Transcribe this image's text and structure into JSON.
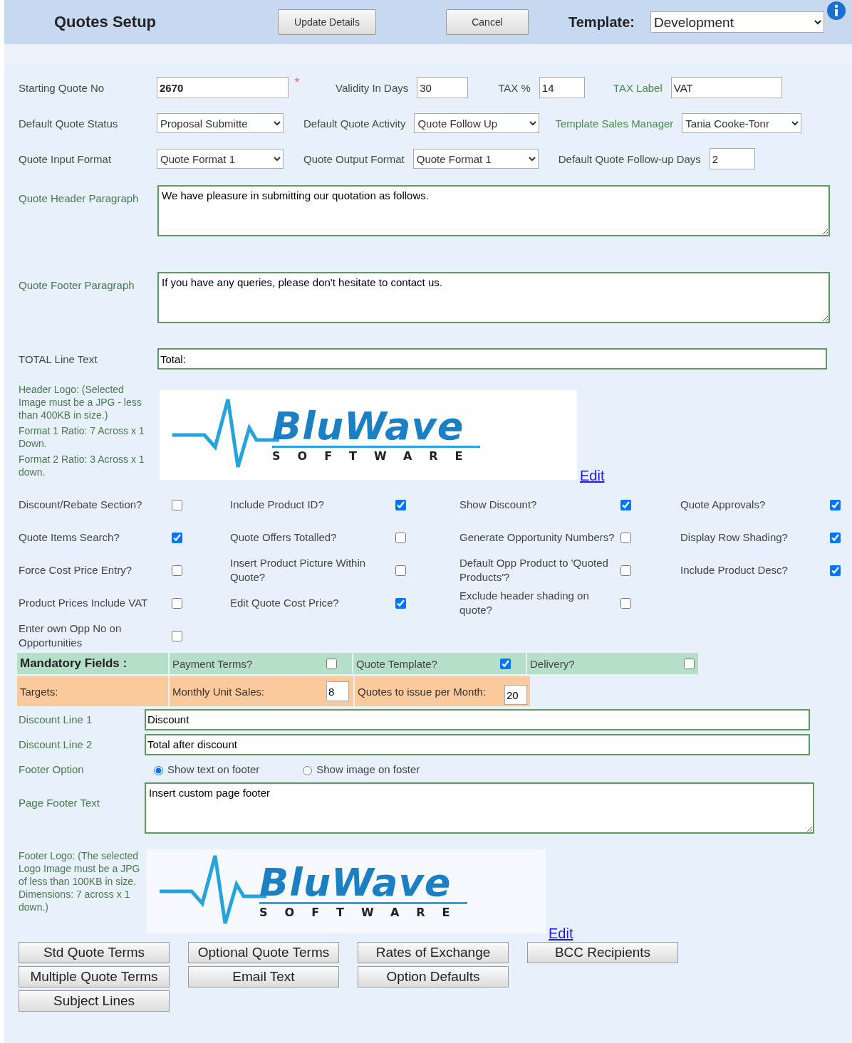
{
  "header": {
    "title": "Quotes Setup",
    "buttons": [
      "Update Details",
      "Cancel"
    ],
    "template_label": "Template:",
    "template_value": "Development"
  },
  "field_rows": [
    [
      {
        "label": "Starting Quote No",
        "kind": "input",
        "value": "2670",
        "required": true
      },
      {
        "label": "Validity In Days",
        "kind": "input",
        "value": "30"
      },
      {
        "label": "TAX %",
        "kind": "input",
        "value": "14"
      },
      {
        "label": "TAX Label",
        "kind": "input",
        "value": "VAT"
      }
    ],
    [
      {
        "label": "Default Quote Status",
        "kind": "select",
        "value": "Proposal Submitte"
      },
      {
        "label": "Default Quote Activity",
        "kind": "select",
        "value": "Quote Follow Up"
      },
      {
        "label": "Template Sales Manager",
        "kind": "select",
        "value": "Tania Cooke-Tonr"
      }
    ],
    [
      {
        "label": "Quote Input Format",
        "kind": "select",
        "value": "Quote Format 1"
      },
      {
        "label": "Quote Output Format",
        "kind": "select",
        "value": "Quote Format 1"
      },
      {
        "label": "Default Quote Follow-up Days",
        "kind": "input",
        "value": "2"
      }
    ]
  ],
  "paragraphs": [
    {
      "label": "Quote Header Paragraph",
      "value": "We have pleasure in submitting our quotation as follows."
    },
    {
      "label": "Quote Footer Paragraph",
      "value": "If you have any queries, please don't hesitate to contact us."
    }
  ],
  "total_line": {
    "label": "TOTAL Line Text",
    "value": "Total:"
  },
  "header_logo": {
    "notes": [
      "Header Logo: (Selected Image must be a JPG - less than 400KB in size.)",
      "Format 1 Ratio: 7 Across x 1 Down.",
      "Format 2 Ratio: 3 Across x 1 down."
    ],
    "wordmark": "BluWave",
    "tagline": "SOFTWARE",
    "edit": "Edit"
  },
  "options": [
    [
      {
        "label": "Discount/Rebate Section?",
        "checked": false
      },
      {
        "label": "Include Product ID?",
        "checked": true
      },
      {
        "label": "Show Discount?",
        "checked": true
      },
      {
        "label": "Quote Approvals?",
        "checked": true
      }
    ],
    [
      {
        "label": "Quote Items Search?",
        "checked": true
      },
      {
        "label": "Quote Offers Totalled?",
        "checked": false
      },
      {
        "label": "Generate Opportunity Numbers?",
        "checked": false
      },
      {
        "label": "Display Row Shading?",
        "checked": true
      }
    ],
    [
      {
        "label": "Force Cost Price Entry?",
        "checked": false
      },
      {
        "label": "Insert Product Picture Within Quote?",
        "checked": false
      },
      {
        "label": "Default Opp Product to 'Quoted Products'?",
        "checked": false
      },
      {
        "label": "Include Product Desc?",
        "checked": true
      }
    ],
    [
      {
        "label": "Product Prices Include VAT",
        "checked": false
      },
      {
        "label": "Edit Quote Cost Price?",
        "checked": true
      },
      {
        "label": "Exclude header shading on quote?",
        "checked": false
      }
    ],
    [
      {
        "label": "Enter own Opp No on Opportunities",
        "checked": false
      }
    ]
  ],
  "mandatory": {
    "label": "Mandatory Fields :",
    "items": [
      {
        "label": "Payment Terms?",
        "checked": false
      },
      {
        "label": "Quote Template?",
        "checked": true
      },
      {
        "label": "Delivery?",
        "checked": false
      }
    ]
  },
  "targets": {
    "label": "Targets:",
    "items": [
      {
        "label": "Monthly Unit Sales:",
        "value": "8"
      },
      {
        "label": "Quotes to issue per Month:",
        "value": "20"
      }
    ]
  },
  "discount_lines": [
    {
      "label": "Discount Line 1",
      "value": "Discount"
    },
    {
      "label": "Discount Line 2",
      "value": "Total after discount"
    }
  ],
  "footer_option": {
    "label": "Footer Option",
    "options": [
      {
        "label": "Show text on footer",
        "selected": true
      },
      {
        "label": "Show image on foster",
        "selected": false
      }
    ]
  },
  "page_footer": {
    "label": "Page Footer Text",
    "value": "Insert custom page footer"
  },
  "footer_logo": {
    "note": "Footer Logo: (The selected Logo Image must be a JPG of less than 100KB in size. Dimensions: 7 across x 1 down.)",
    "wordmark": "BluWave",
    "tagline": "SOFTWARE",
    "edit": "Edit"
  },
  "bottom_buttons": [
    [
      "Std Quote Terms",
      "Optional Quote Terms",
      "Rates of Exchange",
      "BCC Recipients"
    ],
    [
      "Multiple Quote Terms",
      "Email Text",
      "Option Defaults"
    ],
    [
      "Subject Lines"
    ]
  ]
}
